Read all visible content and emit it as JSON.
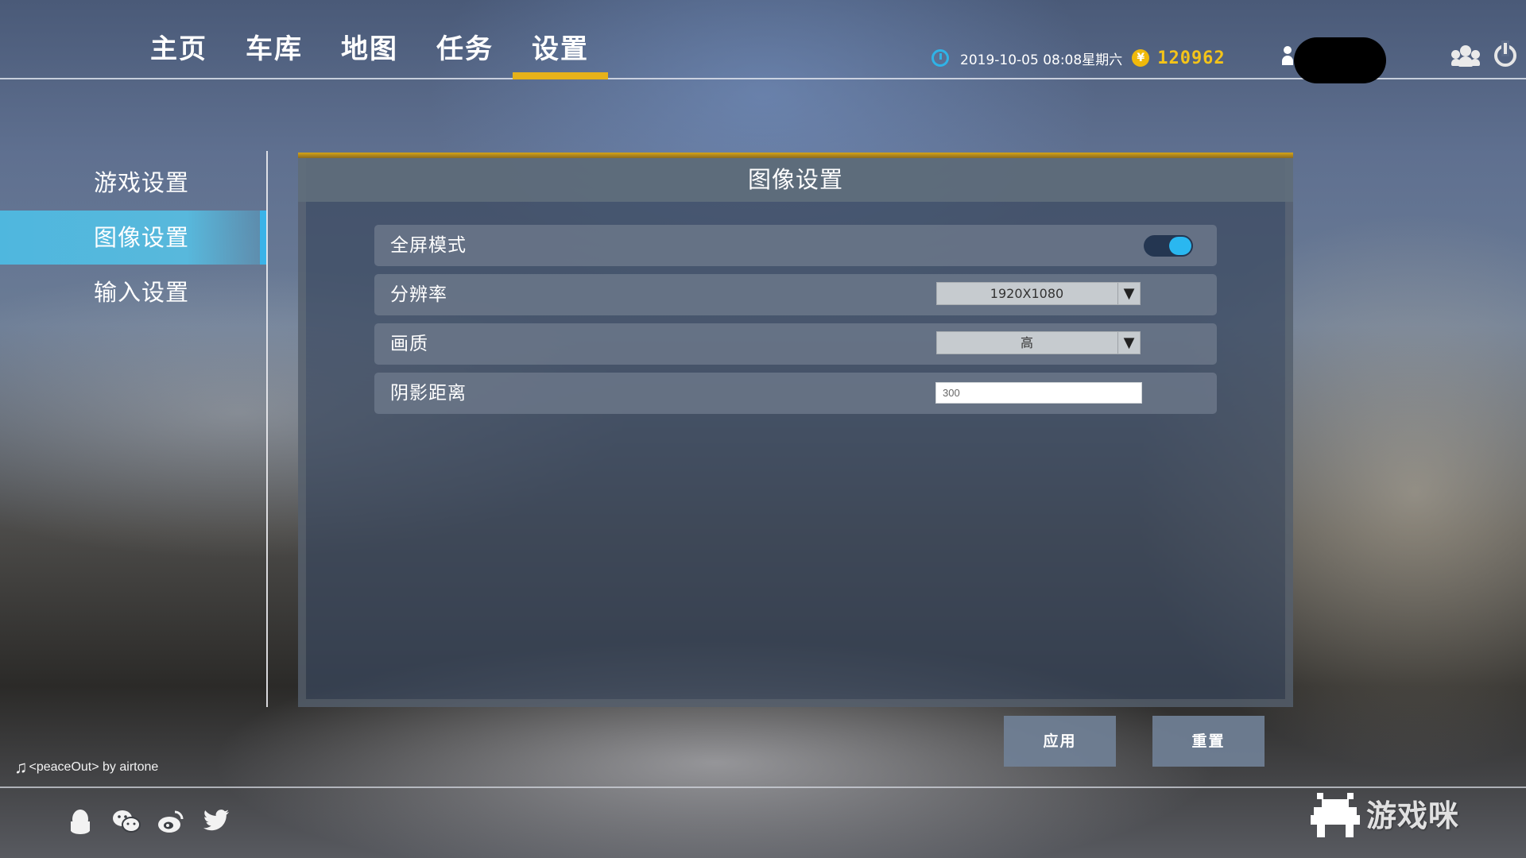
{
  "nav": {
    "items": [
      {
        "label": "主页"
      },
      {
        "label": "车库"
      },
      {
        "label": "地图"
      },
      {
        "label": "任务"
      },
      {
        "label": "设置",
        "active": true
      }
    ]
  },
  "status": {
    "datetime": "2019-10-05 08:08星期六",
    "coin_symbol": "¥",
    "money": "120962",
    "clock_icon": "clock-icon",
    "coin_icon": "coin-icon"
  },
  "header_icons": [
    "user-icon",
    "friends-icon",
    "power-icon"
  ],
  "side_menu": {
    "items": [
      {
        "label": "游戏设置"
      },
      {
        "label": "图像设置",
        "active": true
      },
      {
        "label": "输入设置"
      }
    ]
  },
  "panel": {
    "title": "图像设置",
    "rows": {
      "fullscreen": {
        "label": "全屏模式",
        "enabled": true
      },
      "resolution": {
        "label": "分辨率",
        "value": "1920X1080",
        "arrow": "▼"
      },
      "quality": {
        "label": "画质",
        "value": "高",
        "arrow": "▼"
      },
      "shadow": {
        "label": "阴影距离",
        "value": "300"
      }
    }
  },
  "buttons": {
    "apply": "应用",
    "reset": "重置"
  },
  "footer": {
    "music_icon": "♫",
    "music": "<peaceOut> by airtone",
    "social_icons": [
      "qq-icon",
      "wechat-icon",
      "weibo-icon",
      "twitter-icon"
    ]
  },
  "watermark": {
    "text": "游戏咪"
  },
  "colors": {
    "accent_gold": "#e7b21a",
    "accent_blue": "#3ab3e8",
    "money_yellow": "#f4c419"
  }
}
